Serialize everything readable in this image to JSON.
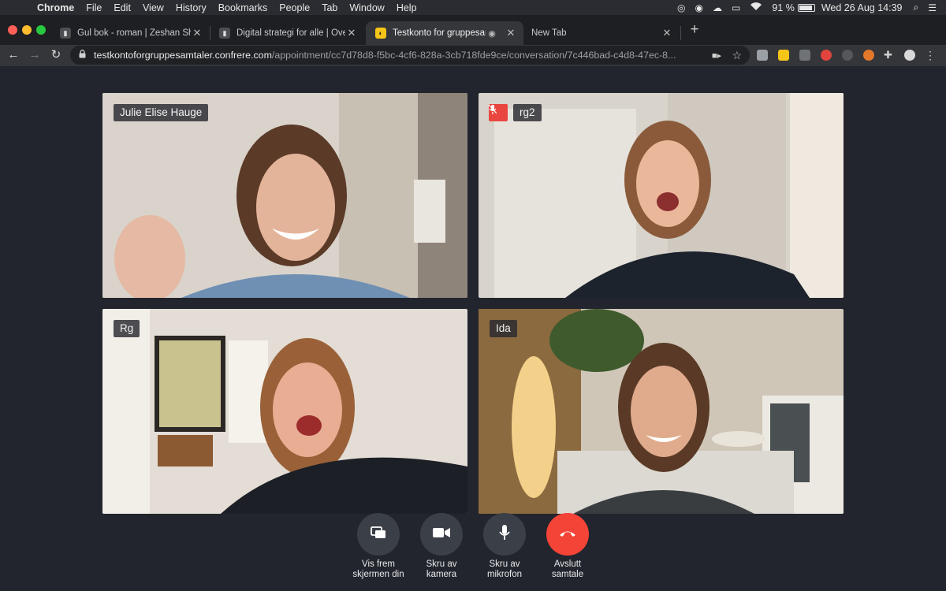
{
  "menubar": {
    "app_name": "Chrome",
    "menus": [
      "File",
      "Edit",
      "View",
      "History",
      "Bookmarks",
      "People",
      "Tab",
      "Window",
      "Help"
    ],
    "battery_percent": "91 %",
    "battery_level": 0.91,
    "datetime": "Wed 26 Aug  14:39"
  },
  "tabs": [
    {
      "title": "Gul bok - roman | Zeshan Shakar",
      "active": false
    },
    {
      "title": "Digital strategi for alle | Ove Dalen",
      "active": false
    },
    {
      "title": "Testkonto for gruppesamtaler",
      "active": true
    },
    {
      "title": "New Tab",
      "active": false
    }
  ],
  "address_bar": {
    "host": "testkontoforgruppesamtaler.confrere.com",
    "path": "/appointment/cc7d78d8-f5bc-4cf6-828a-3cb718fde9ce/conversation/7c446bad-c4d8-47ec-8..."
  },
  "participants": [
    {
      "name": "Julie Elise Hauge",
      "muted": false
    },
    {
      "name": "rg2",
      "muted": true
    },
    {
      "name": "Rg",
      "muted": false
    },
    {
      "name": "Ida",
      "muted": false
    }
  ],
  "controls": {
    "share": "Vis frem\nskjermen din",
    "camera": "Skru av\nkamera",
    "mic": "Skru av\nmikrofon",
    "end": "Avslutt\nsamtale"
  },
  "colors": {
    "background": "#22252d",
    "control_button": "#3b3f48",
    "end_call": "#f44437",
    "mute_badge": "#e8463e"
  },
  "icons": {
    "share": "screen-share-icon",
    "camera": "video-camera-icon",
    "mic": "microphone-icon",
    "end": "hang-up-icon",
    "mute": "mic-off-icon"
  }
}
